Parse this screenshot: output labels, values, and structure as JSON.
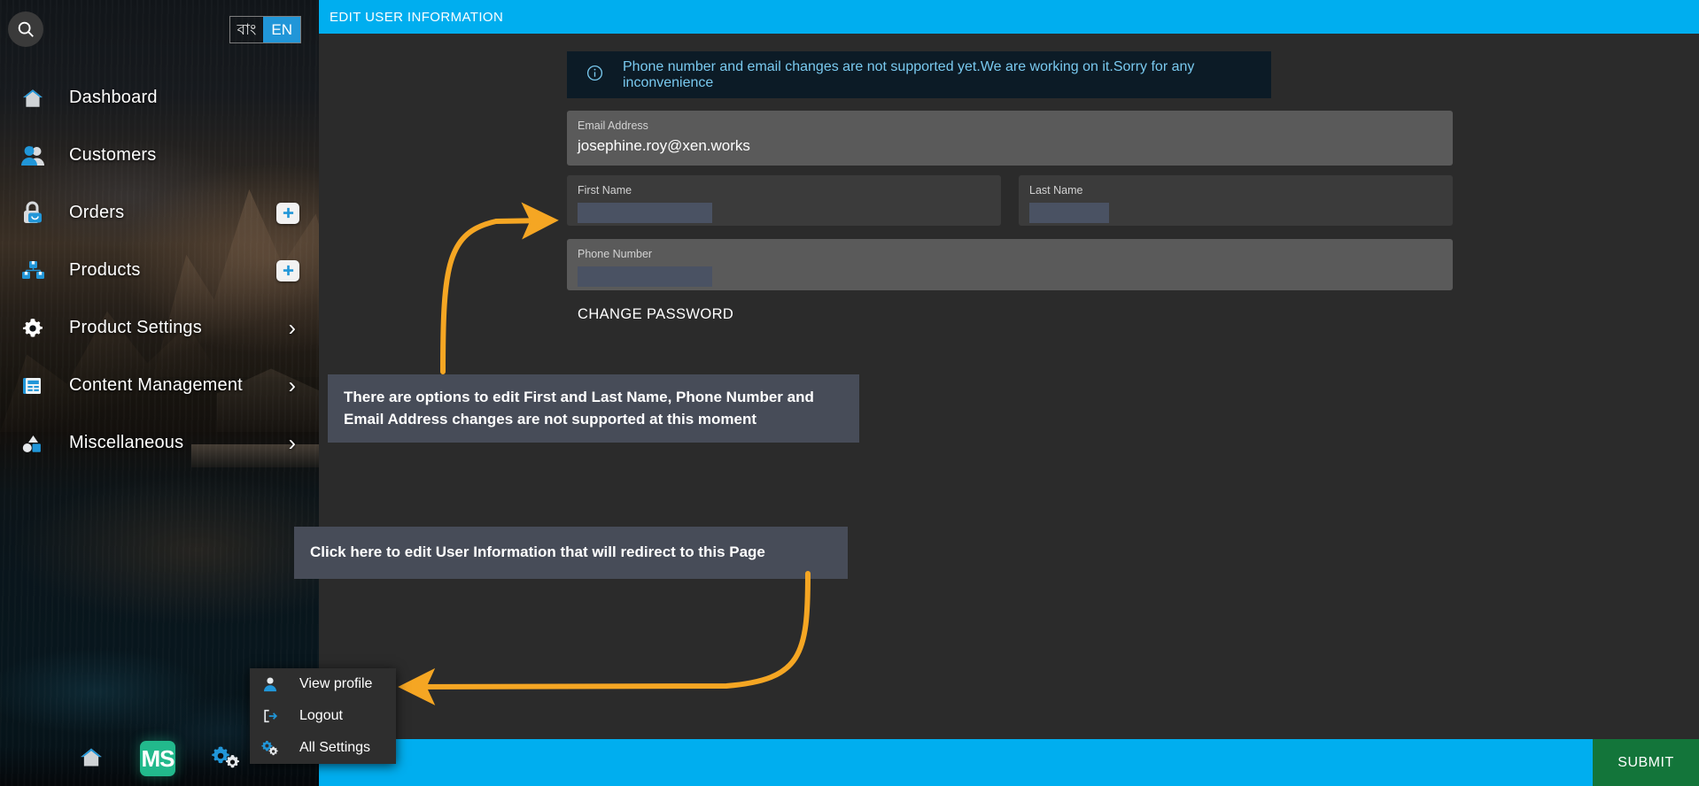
{
  "sidebar": {
    "search_icon": "search-icon",
    "language": {
      "bn_label": "বাং",
      "en_label": "EN",
      "selected": "EN"
    },
    "items": [
      {
        "label": "Dashboard",
        "icon": "home-icon",
        "trailing": "none"
      },
      {
        "label": "Customers",
        "icon": "customers-icon",
        "trailing": "none"
      },
      {
        "label": "Orders",
        "icon": "orders-bag-icon",
        "trailing": "plus-badge"
      },
      {
        "label": "Products",
        "icon": "products-boxes-icon",
        "trailing": "plus-badge"
      },
      {
        "label": "Product Settings",
        "icon": "gear-icon",
        "trailing": "chevron-right-icon"
      },
      {
        "label": "Content Management",
        "icon": "content-document-icon",
        "trailing": "chevron-right-icon"
      },
      {
        "label": "Miscellaneous",
        "icon": "shapes-icon",
        "trailing": "chevron-right-icon"
      }
    ],
    "taskbar": [
      {
        "name": "home-icon",
        "label": ""
      },
      {
        "name": "ms-logo",
        "label": "MS"
      },
      {
        "name": "gears-icon",
        "label": ""
      }
    ]
  },
  "context_menu": {
    "items": [
      {
        "label": "View profile",
        "icon": "person-icon"
      },
      {
        "label": "Logout",
        "icon": "logout-icon"
      },
      {
        "label": "All Settings",
        "icon": "gears-icon"
      }
    ]
  },
  "header": {
    "title": "EDIT USER INFORMATION"
  },
  "info_banner": {
    "icon": "info-circle-icon",
    "message": "Phone number and email changes are not supported yet.We are working on it.Sorry for any inconvenience"
  },
  "form": {
    "email": {
      "label": "Email Address",
      "value": "josephine.roy@xen.works"
    },
    "first_name": {
      "label": "First Name",
      "value": ""
    },
    "last_name": {
      "label": "Last Name",
      "value": ""
    },
    "phone": {
      "label": "Phone Number",
      "value": ""
    },
    "change_password_label": "CHANGE PASSWORD"
  },
  "annotations": {
    "note1": "There are options to edit First and Last Name, Phone Number and Email Address changes are not supported at this moment",
    "note2": "Click here to edit User Information that will redirect to this Page"
  },
  "footer": {
    "submit_label": "SUBMIT"
  },
  "colors": {
    "accent_cyan": "#00aeef",
    "submit_green": "#13753a",
    "annotation_arrow": "#f5a623",
    "note_bg": "#474c58",
    "info_text": "#79c9ef"
  }
}
